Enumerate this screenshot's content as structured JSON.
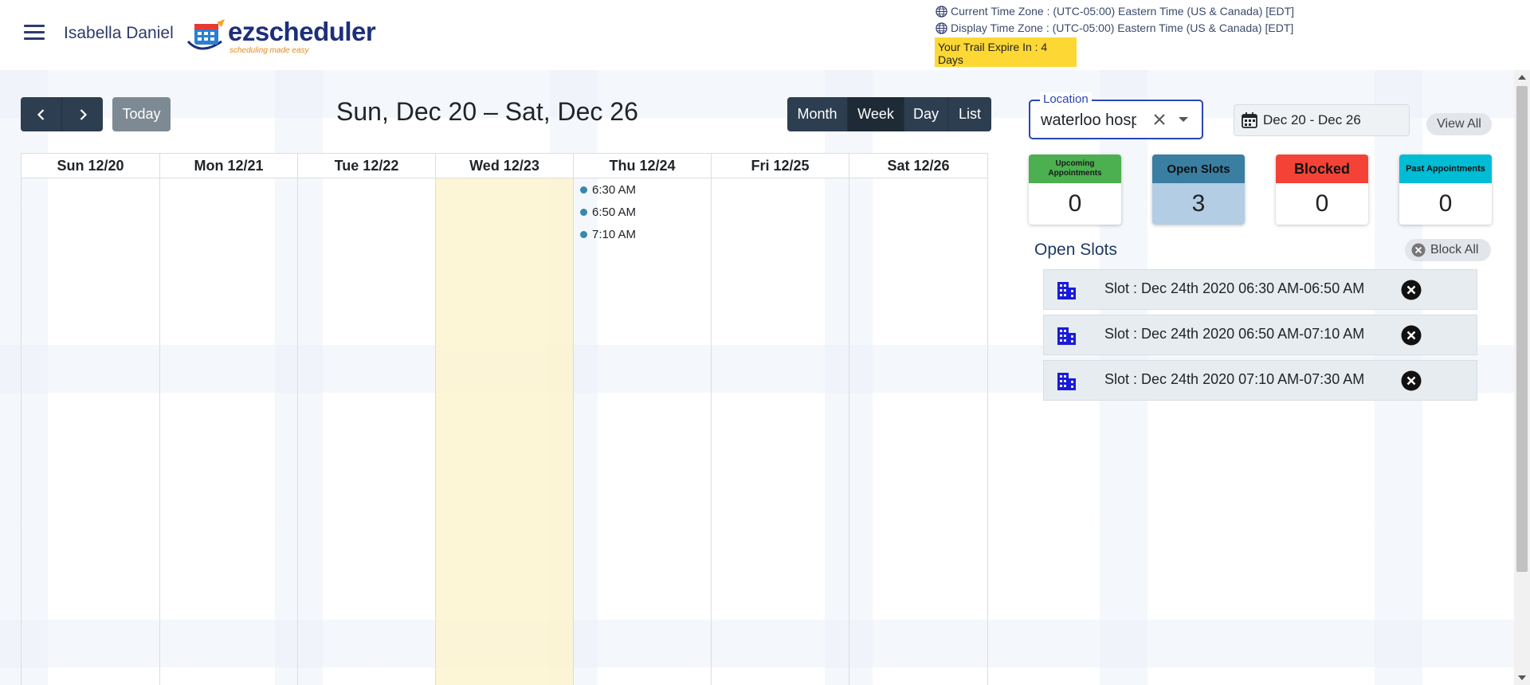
{
  "header": {
    "username": "Isabella Daniel",
    "logo": {
      "brand": "ezscheduler",
      "tagline": "scheduling made easy"
    },
    "current_timezone": "Current Time Zone : (UTC-05:00) Eastern Time (US & Canada) [EDT]",
    "display_timezone": "Display Time Zone : (UTC-05:00) Eastern Time (US & Canada) [EDT]",
    "trial_notice": "Your Trail Expire In : 4 Days",
    "icons": {
      "menu": "hamburger-menu-icon",
      "globe": "globe-icon"
    }
  },
  "calendar": {
    "today_label": "Today",
    "range_title": "Sun, Dec 20 – Sat, Dec 26",
    "views": [
      "Month",
      "Week",
      "Day",
      "List"
    ],
    "active_view": "Week",
    "days": [
      "Sun 12/20",
      "Mon 12/21",
      "Tue 12/22",
      "Wed 12/23",
      "Thu 12/24",
      "Fri 12/25",
      "Sat 12/26"
    ],
    "highlighted_day": "Wed 12/23",
    "events": [
      {
        "day": "Thu 12/24",
        "time": "6:30 AM"
      },
      {
        "day": "Thu 12/24",
        "time": "6:50 AM"
      },
      {
        "day": "Thu 12/24",
        "time": "7:10 AM"
      }
    ],
    "event_color": "#3a87ad"
  },
  "sidebar": {
    "location": {
      "label": "Location",
      "value": "waterloo hospital"
    },
    "date_range": "Dec 20 - Dec 26",
    "view_all_label": "View All",
    "cards": [
      {
        "label": "Upcoming Appointments",
        "value": "0",
        "color": "#4caf50"
      },
      {
        "label": "Open Slots",
        "value": "3",
        "color": "#3a7ea1"
      },
      {
        "label": "Blocked",
        "value": "0",
        "color": "#f44336"
      },
      {
        "label": "Past Appointments",
        "value": "0",
        "color": "#00bcd4"
      }
    ],
    "open_slots_title": "Open Slots",
    "block_all_label": "Block All",
    "slots": [
      {
        "text": "Slot : Dec 24th 2020 06:30 AM-06:50 AM"
      },
      {
        "text": "Slot : Dec 24th 2020 06:50 AM-07:10 AM"
      },
      {
        "text": "Slot : Dec 24th 2020 07:10 AM-07:30 AM"
      }
    ]
  }
}
